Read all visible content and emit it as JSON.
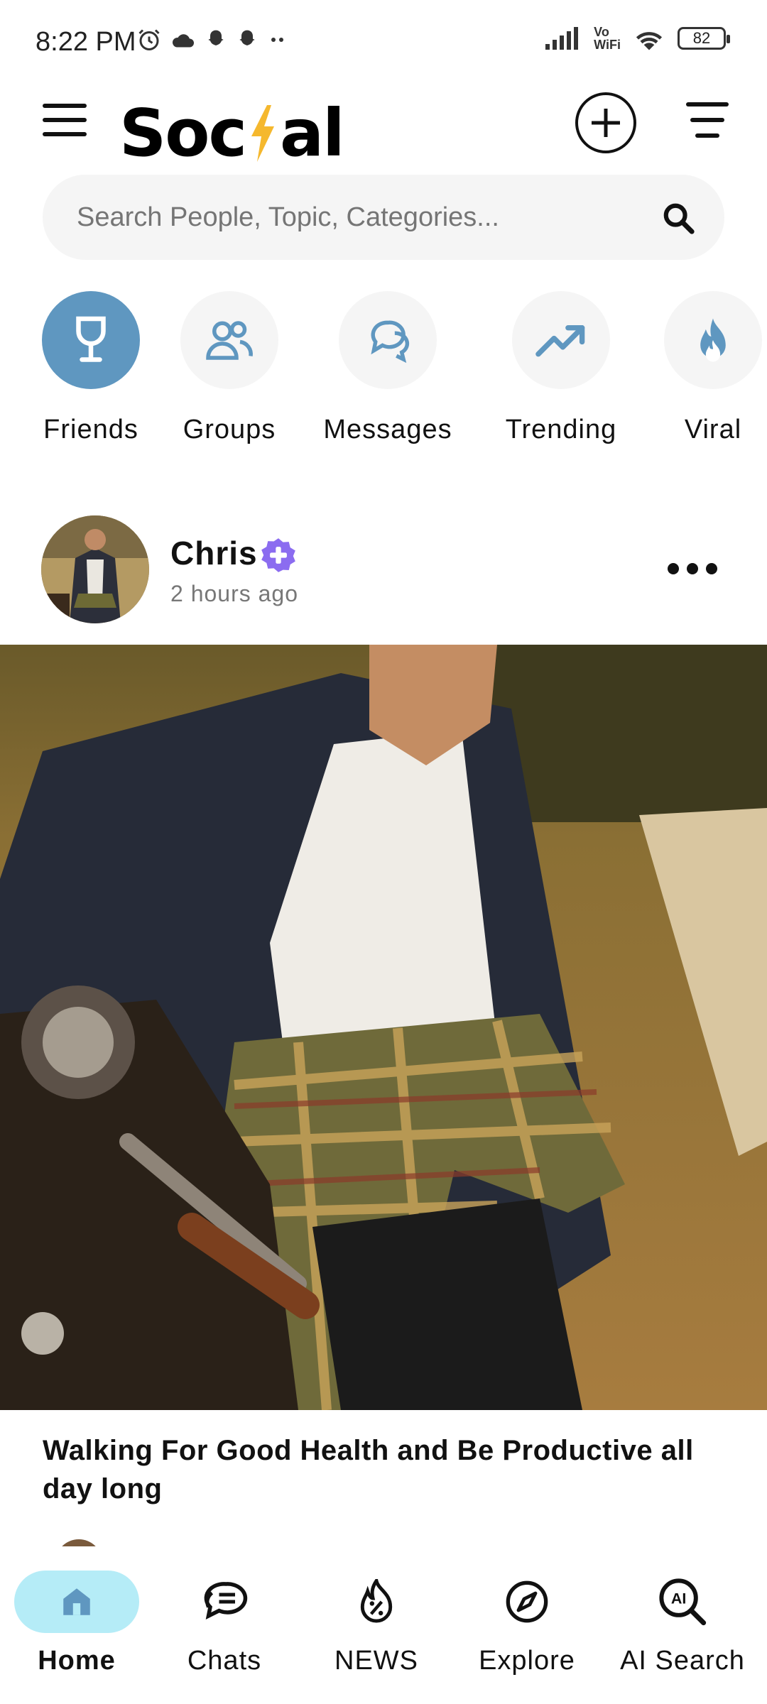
{
  "status_bar": {
    "time": "8:22 PM",
    "vowifi_top": "Vo",
    "vowifi_bottom": "WiFi",
    "battery": "82"
  },
  "header": {
    "logo_left": "Soc",
    "logo_right": "al",
    "bolt_color": "#f5b82e"
  },
  "search": {
    "placeholder": "Search People, Topic, Categories..."
  },
  "categories": [
    {
      "label": "Friends",
      "icon": "glass-icon",
      "active": true
    },
    {
      "label": "Groups",
      "icon": "users-icon"
    },
    {
      "label": "Messages",
      "icon": "chat-bubbles-icon"
    },
    {
      "label": "Trending",
      "icon": "trending-up-icon"
    },
    {
      "label": "Viral",
      "icon": "fire-icon"
    }
  ],
  "post": {
    "author": "Chris",
    "time": "2 hours ago",
    "title": "Walking For Good Health and Be Productive all day long"
  },
  "nav": [
    {
      "label": "Home",
      "icon": "home-icon",
      "active": true
    },
    {
      "label": "Chats",
      "icon": "chat-icon"
    },
    {
      "label": "NEWS",
      "icon": "fire-percent-icon"
    },
    {
      "label": "Explore",
      "icon": "compass-icon"
    },
    {
      "label": "AI Search",
      "icon": "ai-search-icon"
    }
  ],
  "colors": {
    "accent": "#5f97c0",
    "nav_active": "#b5ecf7",
    "verified": "#8b6cf0"
  }
}
